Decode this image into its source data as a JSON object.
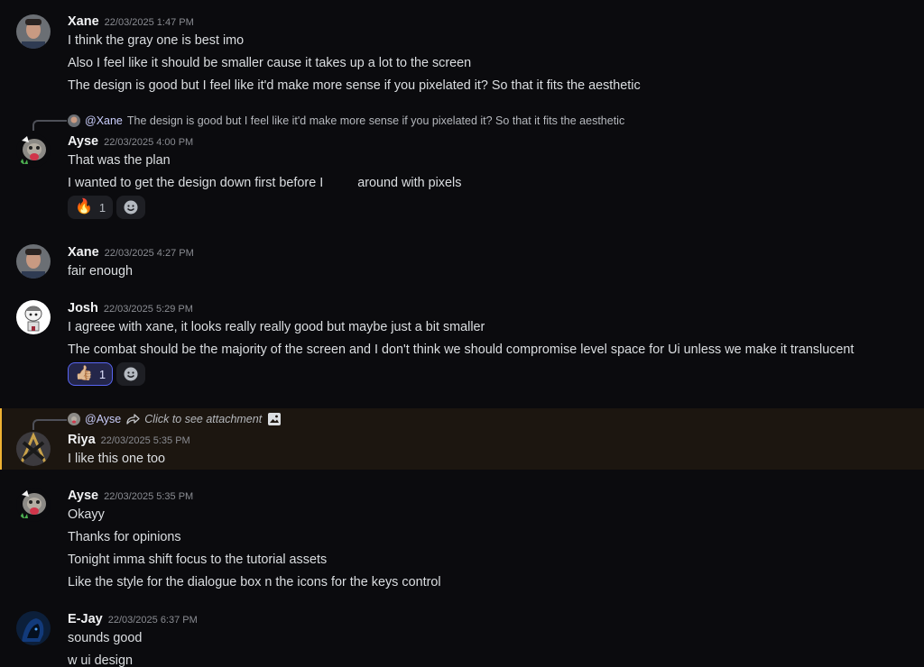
{
  "messages": [
    {
      "author": "Xane",
      "timestamp": "22/03/2025 1:47 PM",
      "lines": [
        "I think the gray one is best imo",
        "Also I feel like it should be smaller cause it takes up a lot to the screen",
        "The design is good but I feel like it'd make more sense if you pixelated it? So that it fits the aesthetic"
      ]
    },
    {
      "reply": {
        "mention": "@Xane",
        "text": "The design is good but I feel like it'd make more sense if you pixelated it? So that it fits the aesthetic"
      },
      "author": "Ayse",
      "timestamp": "22/03/2025 4:00 PM",
      "lines": [
        "That was the plan",
        "I wanted to get the design down first before I",
        "around with pixels"
      ],
      "reactions": [
        {
          "emoji": "🔥",
          "emoji_name": "fire",
          "count": "1"
        }
      ]
    },
    {
      "author": "Xane",
      "timestamp": "22/03/2025 4:27 PM",
      "lines": [
        "fair enough"
      ]
    },
    {
      "author": "Josh",
      "timestamp": "22/03/2025 5:29 PM",
      "lines": [
        "I agreee with xane, it looks really really good but maybe just a bit smaller",
        "The combat should be the majority of the screen and I don't think we should compromise level space for Ui unless we make it translucent"
      ],
      "reactions": [
        {
          "emoji": "👍🏼",
          "emoji_name": "thumbs-up",
          "count": "1"
        }
      ]
    },
    {
      "reply": {
        "mention": "@Ayse",
        "text": "Click to see attachment"
      },
      "author": "Riya",
      "timestamp": "22/03/2025 5:35 PM",
      "lines": [
        "I like this one too"
      ],
      "highlight_color": "#f0b232"
    },
    {
      "author": "Ayse",
      "timestamp": "22/03/2025 5:35 PM",
      "lines": [
        "Okayy",
        "Thanks for opinions",
        "Tonight imma shift focus to the tutorial assets",
        "Like the style for the dialogue box n the icons for the keys control"
      ]
    },
    {
      "author": "E-Jay",
      "timestamp": "22/03/2025 6:37 PM",
      "lines": [
        "sounds good",
        "w ui design"
      ]
    }
  ],
  "icons": {
    "add_reaction": "smiley-plus-icon",
    "reply_arrow": "reply-arrow-icon",
    "attachment": "image-icon"
  },
  "colors": {
    "background": "#0b0b0e",
    "mention_highlight": "#f0b232",
    "reaction_active": "#5865f2"
  }
}
